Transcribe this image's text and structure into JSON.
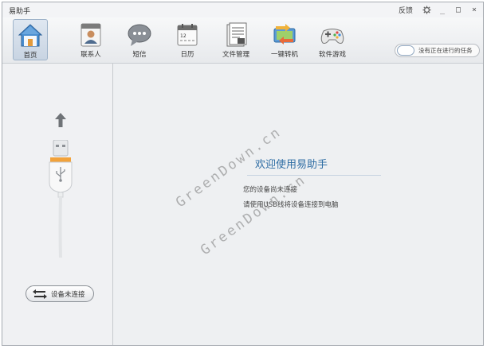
{
  "window": {
    "title": "易助手",
    "feedback_label": "反馈",
    "min_glyph": "_",
    "max_glyph": "□",
    "close_glyph": "×"
  },
  "toolbar": {
    "items": [
      {
        "label": "首页",
        "icon": "home-icon"
      },
      {
        "label": "联系人",
        "icon": "contacts-icon"
      },
      {
        "label": "短信",
        "icon": "sms-icon"
      },
      {
        "label": "日历",
        "icon": "calendar-icon"
      },
      {
        "label": "文件管理",
        "icon": "file-manager-icon"
      },
      {
        "label": "一键转机",
        "icon": "phone-transfer-icon"
      },
      {
        "label": "软件游戏",
        "icon": "gamepad-icon"
      }
    ],
    "calendar_day": "12",
    "task_label": "没有正在进行的任务"
  },
  "sidebar": {
    "status_label": "设备未连接"
  },
  "main": {
    "welcome_title": "欢迎使用易助手",
    "line1": "您的设备尚未连接",
    "line2": "请使用USB线将设备连接到电脑"
  },
  "watermark": {
    "text": "GreenDown.cn"
  },
  "colors": {
    "accent": "#2e6da4",
    "usb_orange": "#f2a23a"
  }
}
